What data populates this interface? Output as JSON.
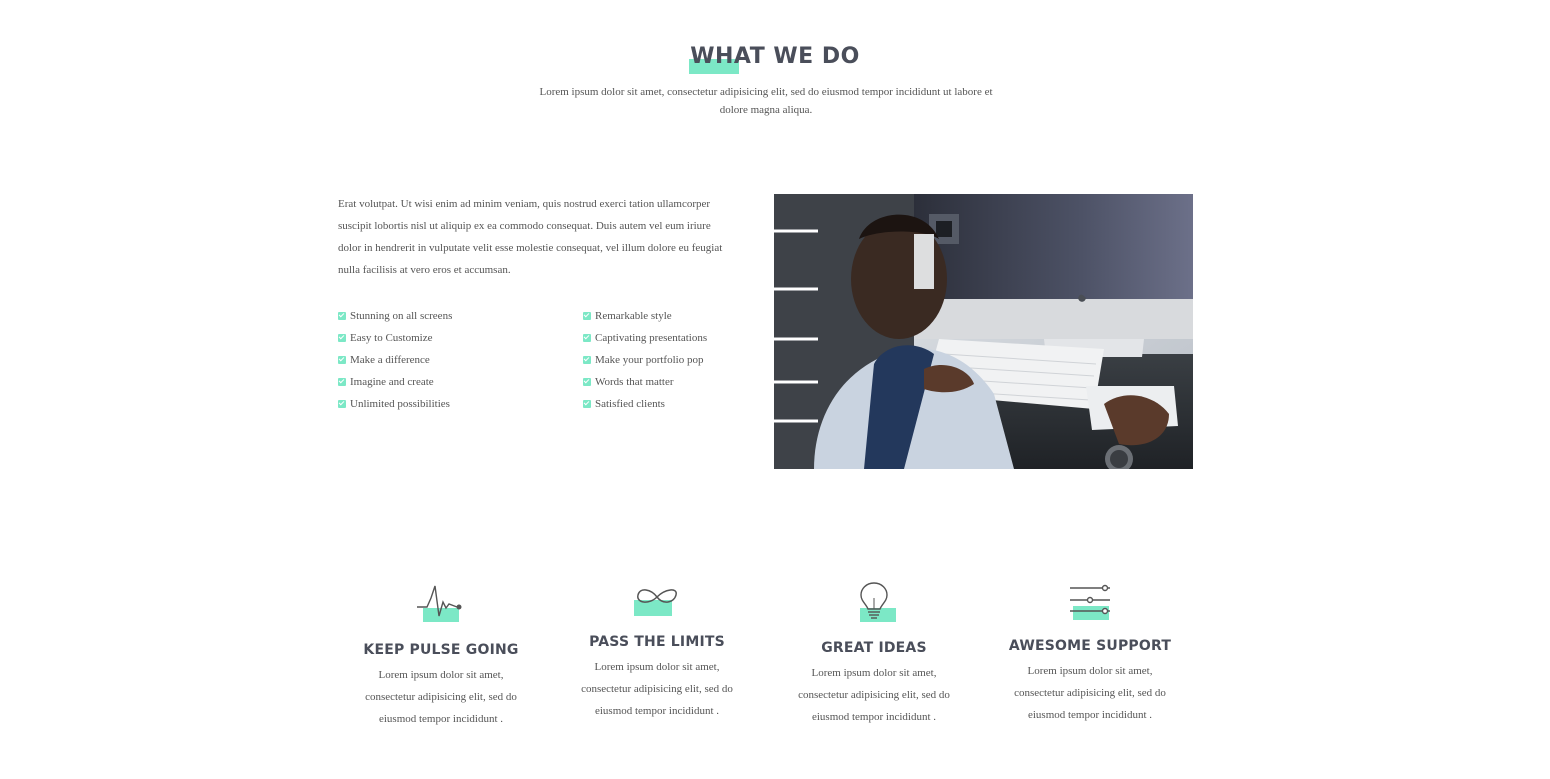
{
  "header": {
    "title": "WHAT WE DO",
    "subtitle": "Lorem ipsum dolor sit amet, consectetur adipisicing elit, sed do eiusmod tempor incididunt ut labore et dolore magna aliqua."
  },
  "about": {
    "paragraph": "Erat volutpat. Ut wisi enim ad minim veniam, quis nostrud exerci tation ullamcorper suscipit lobortis nisl ut aliquip ex ea commodo consequat. Duis autem vel eum iriure dolor in hendrerit in vulputate velit esse molestie consequat, vel illum dolore eu feugiat nulla facilisis at vero eros et accumsan.",
    "features_left": [
      "Stunning on all screens",
      "Easy to Customize",
      "Make a difference",
      "Imagine and create",
      "Unlimited possibilities"
    ],
    "features_right": [
      "Remarkable style",
      "Captivating presentations",
      "Make your portfolio pop",
      "Words that matter",
      "Satisfied clients"
    ]
  },
  "services": [
    {
      "icon": "pulse-icon",
      "title": "KEEP PULSE GOING",
      "text": "Lorem ipsum dolor sit amet, consectetur adipisicing elit, sed do eiusmod tempor incididunt ."
    },
    {
      "icon": "infinity-icon",
      "title": "PASS THE LIMITS",
      "text": "Lorem ipsum dolor sit amet, consectetur adipisicing elit, sed do eiusmod tempor incididunt ."
    },
    {
      "icon": "lightbulb-icon",
      "title": "GREAT IDEAS",
      "text": "Lorem ipsum dolor sit amet, consectetur adipisicing elit, sed do eiusmod tempor incididunt ."
    },
    {
      "icon": "sliders-icon",
      "title": "AWESOME SUPPORT",
      "text": "Lorem ipsum dolor sit amet, consectetur adipisicing elit, sed do eiusmod tempor incididunt ."
    }
  ],
  "colors": {
    "accent": "#7ce8c6",
    "heading": "#4a4e5a",
    "body_text": "#555555"
  }
}
